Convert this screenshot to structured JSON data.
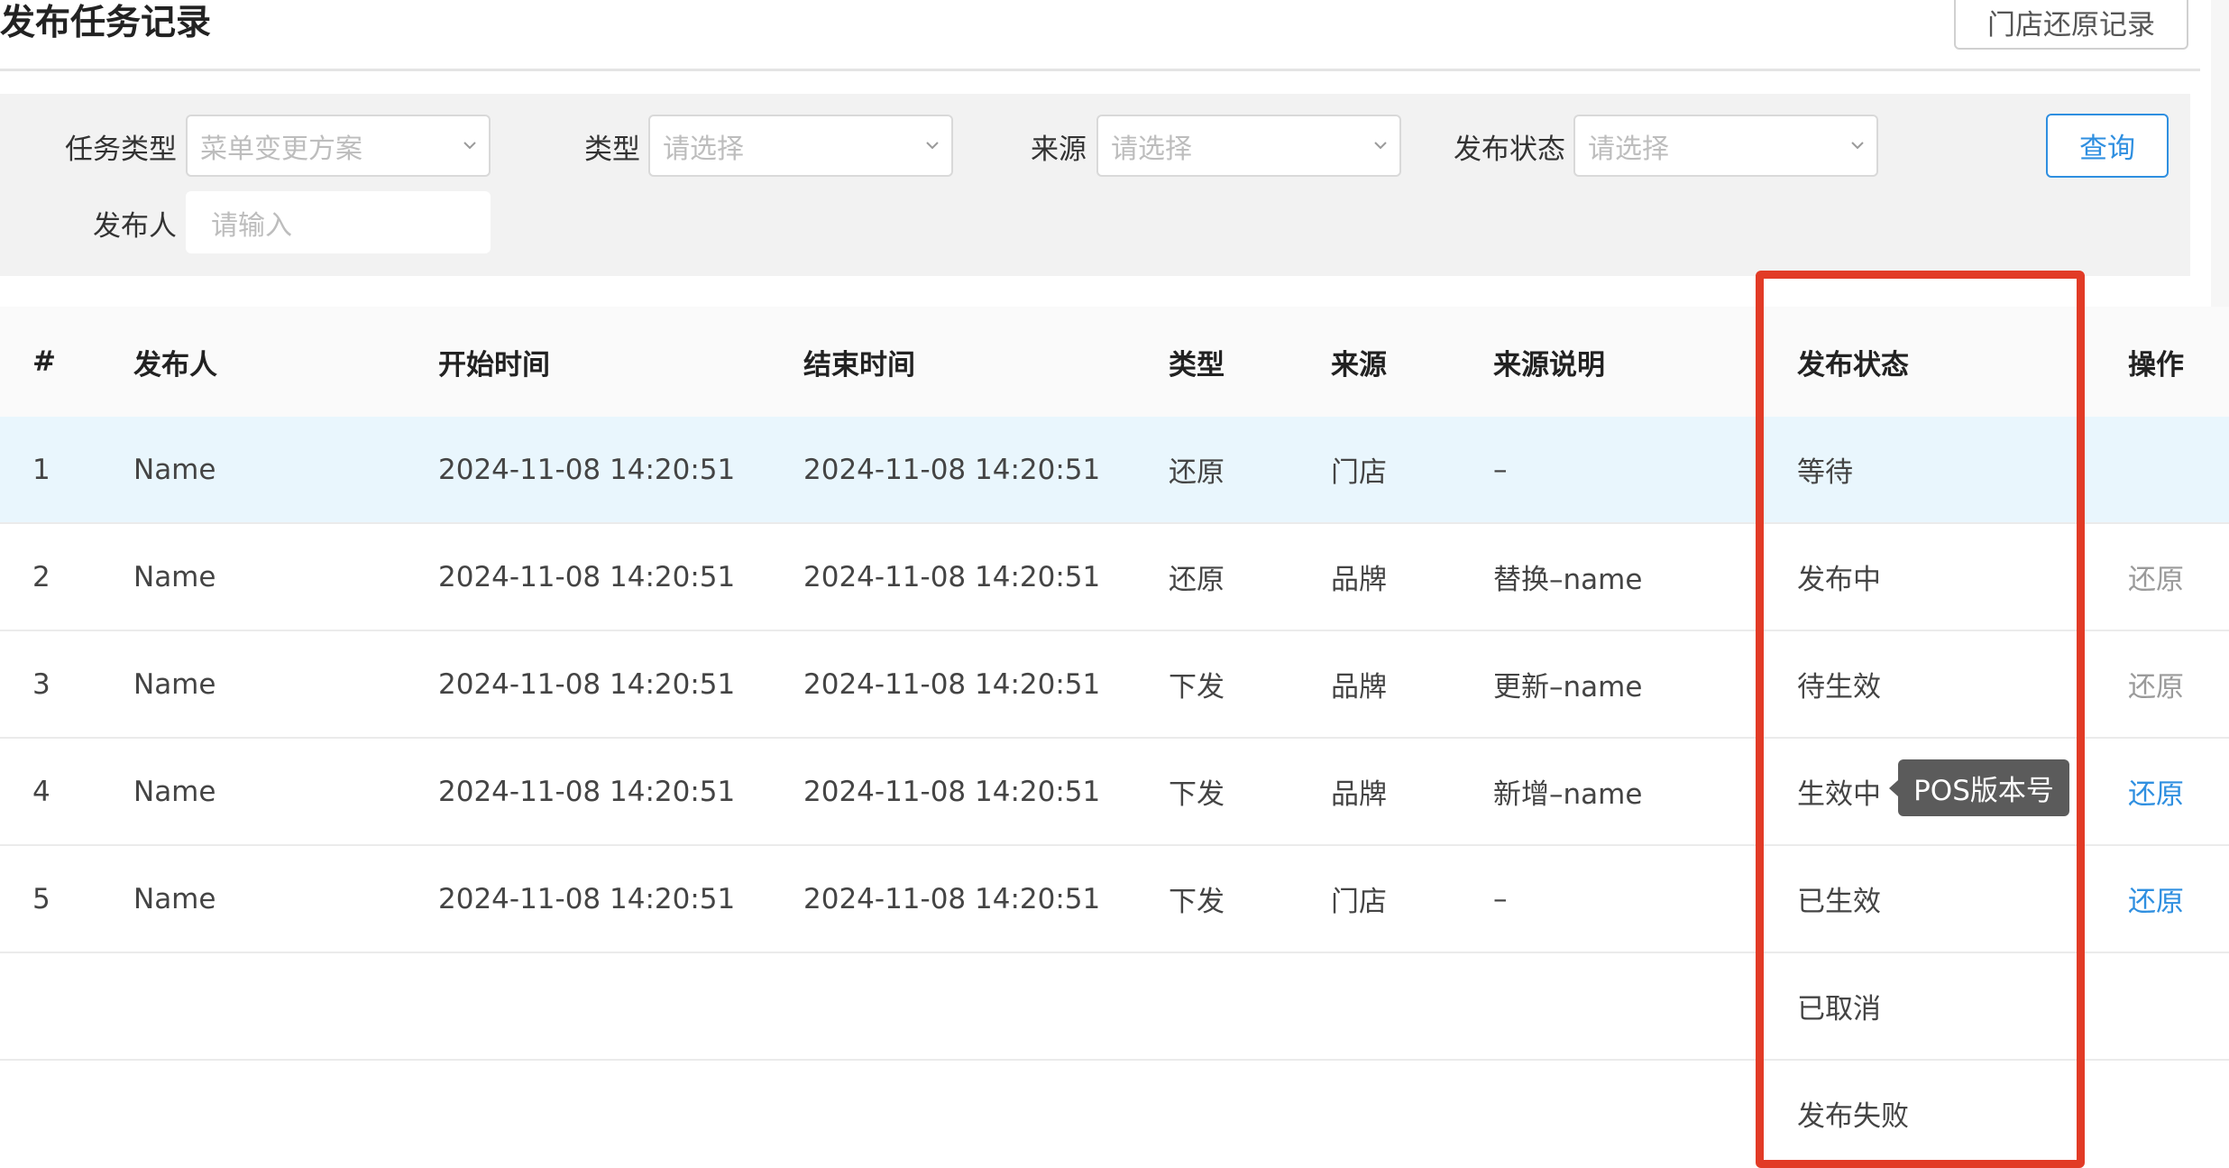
{
  "header": {
    "title": "发布任务记录",
    "restore_log_button": "门店还原记录"
  },
  "filters": {
    "task_type": {
      "label": "任务类型",
      "placeholder": "菜单变更方案"
    },
    "type": {
      "label": "类型",
      "placeholder": "请选择"
    },
    "source": {
      "label": "来源",
      "placeholder": "请选择"
    },
    "status": {
      "label": "发布状态",
      "placeholder": "请选择"
    },
    "publisher": {
      "label": "发布人",
      "placeholder": "请输入"
    },
    "query_button": "查询"
  },
  "table": {
    "columns": [
      "#",
      "发布人",
      "开始时间",
      "结束时间",
      "类型",
      "来源",
      "来源说明",
      "发布状态",
      "操作"
    ],
    "rows": [
      {
        "idx": "1",
        "publisher": "Name",
        "start": "2024-11-08 14:20:51",
        "end": "2024-11-08 14:20:51",
        "type": "还原",
        "source": "门店",
        "note": "–",
        "status": "等待",
        "action": ""
      },
      {
        "idx": "2",
        "publisher": "Name",
        "start": "2024-11-08 14:20:51",
        "end": "2024-11-08 14:20:51",
        "type": "还原",
        "source": "品牌",
        "note": "替换–name",
        "status": "发布中",
        "action": "还原"
      },
      {
        "idx": "3",
        "publisher": "Name",
        "start": "2024-11-08 14:20:51",
        "end": "2024-11-08 14:20:51",
        "type": "下发",
        "source": "品牌",
        "note": "更新–name",
        "status": "待生效",
        "action": "还原"
      },
      {
        "idx": "4",
        "publisher": "Name",
        "start": "2024-11-08 14:20:51",
        "end": "2024-11-08 14:20:51",
        "type": "下发",
        "source": "品牌",
        "note": "新增–name",
        "status": "生效中",
        "action": "还原"
      },
      {
        "idx": "5",
        "publisher": "Name",
        "start": "2024-11-08 14:20:51",
        "end": "2024-11-08 14:20:51",
        "type": "下发",
        "source": "门店",
        "note": "–",
        "status": "已生效",
        "action": "还原"
      }
    ],
    "extra_statuses": [
      "已取消",
      "发布失败"
    ]
  },
  "tooltip": "POS版本号",
  "colors": {
    "accent": "#2f8fe0",
    "highlight_box": "#e23b26",
    "row_hover": "#e9f6fd",
    "disabled_action": "#9a9a9a"
  }
}
